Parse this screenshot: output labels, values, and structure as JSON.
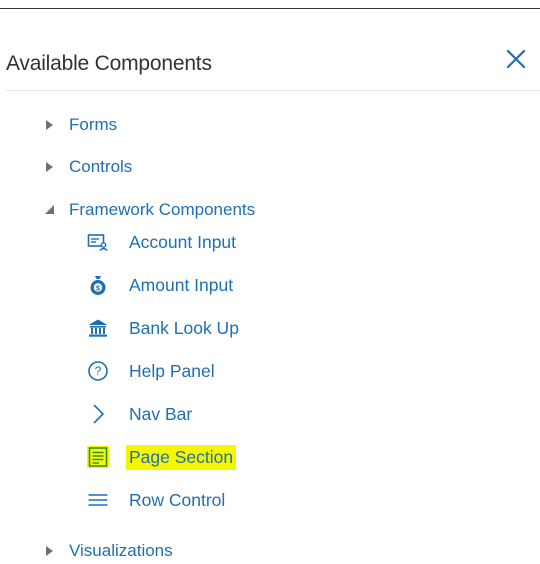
{
  "panel": {
    "title": "Available Components",
    "close_icon": "close-icon",
    "accent_color": "#1f6fb2",
    "highlight_color": "#f6f600"
  },
  "tree": {
    "forms": {
      "label": "Forms",
      "expanded": false
    },
    "controls": {
      "label": "Controls",
      "expanded": false
    },
    "framework": {
      "label": "Framework Components",
      "expanded": true,
      "items": [
        {
          "label": "Account Input",
          "icon": "account-input-icon"
        },
        {
          "label": "Amount Input",
          "icon": "money-bag-icon"
        },
        {
          "label": "Bank Look Up",
          "icon": "bank-icon"
        },
        {
          "label": "Help Panel",
          "icon": "help-circle-icon"
        },
        {
          "label": "Nav Bar",
          "icon": "chevron-right-icon"
        },
        {
          "label": "Page Section",
          "icon": "page-section-icon",
          "highlighted": true
        },
        {
          "label": "Row Control",
          "icon": "rows-icon"
        }
      ]
    },
    "visualizations": {
      "label": "Visualizations",
      "expanded": false
    }
  }
}
